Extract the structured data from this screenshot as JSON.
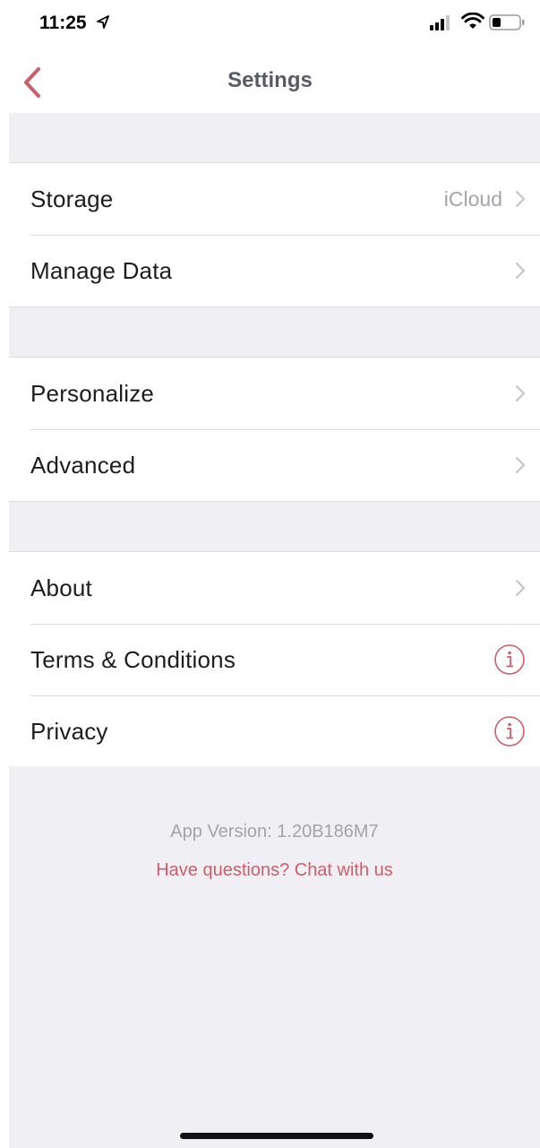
{
  "status_bar": {
    "time": "11:25"
  },
  "nav": {
    "title": "Settings"
  },
  "colors": {
    "accent": "#cc5e6b",
    "grouped_bg": "#efeff4",
    "secondary_text": "#a3a3aa"
  },
  "groups": [
    {
      "rows": [
        {
          "label": "Storage",
          "detail": "iCloud",
          "accessory": "chevron-icon"
        },
        {
          "label": "Manage Data",
          "accessory": "chevron-icon"
        }
      ]
    },
    {
      "rows": [
        {
          "label": "Personalize",
          "accessory": "chevron-icon"
        },
        {
          "label": "Advanced",
          "accessory": "chevron-icon"
        }
      ]
    },
    {
      "rows": [
        {
          "label": "About",
          "accessory": "chevron-icon"
        },
        {
          "label": "Terms & Conditions",
          "accessory": "info-icon"
        },
        {
          "label": "Privacy",
          "accessory": "info-icon"
        }
      ]
    }
  ],
  "footer": {
    "version": "App Version: 1.20B186M7",
    "chat_link": "Have questions? Chat with us"
  }
}
